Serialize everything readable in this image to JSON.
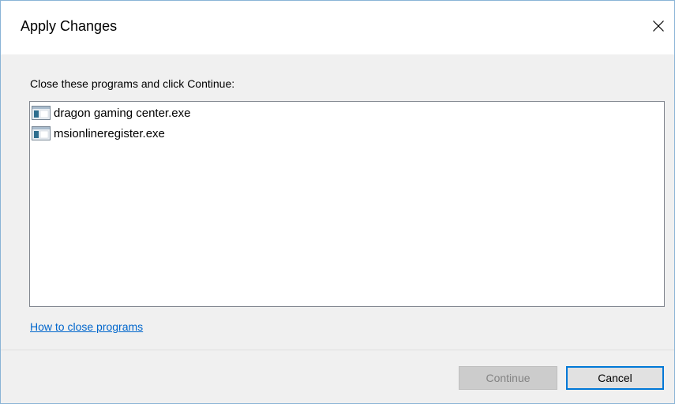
{
  "window": {
    "title": "Apply Changes"
  },
  "dialog": {
    "instruction": "Close these programs and click Continue:",
    "programs": [
      {
        "name": "dragon gaming center.exe",
        "icon": "exe-window-icon"
      },
      {
        "name": "msionlineregister.exe",
        "icon": "exe-window-icon"
      }
    ],
    "help_link": "How to close programs"
  },
  "buttons": {
    "continue_label": "Continue",
    "continue_enabled": false,
    "cancel_label": "Cancel"
  },
  "colors": {
    "accent": "#0078d7",
    "link": "#0066cc",
    "disabled_text": "#838383"
  }
}
